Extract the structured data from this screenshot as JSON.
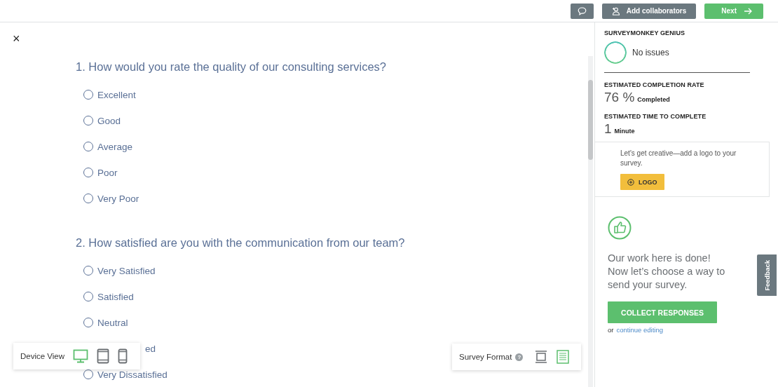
{
  "topbar": {
    "buttons": [
      {
        "kind": "comment"
      },
      {
        "kind": "collaborators",
        "label": "Add collaborators"
      },
      {
        "kind": "next",
        "label": "Next"
      }
    ]
  },
  "close_icon": "×",
  "questions": [
    {
      "title": "1. How would you rate the quality of our consulting services?",
      "options": [
        {
          "kind": "radio",
          "label": "Excellent",
          "selected": false
        },
        {
          "kind": "radio",
          "label": "Good",
          "selected": false
        },
        {
          "kind": "radio",
          "label": "Average",
          "selected": false
        },
        {
          "kind": "radio",
          "label": "Poor",
          "selected": false
        },
        {
          "kind": "radio",
          "label": "Very Poor",
          "selected": false
        }
      ]
    },
    {
      "title": "2. How satisfied are you with the communication from our team?",
      "options": [
        {
          "kind": "radio",
          "label": "Very Satisfied",
          "selected": false
        },
        {
          "kind": "radio",
          "label": "Satisfied",
          "selected": false
        },
        {
          "kind": "radio",
          "label": "Neutral",
          "selected": false
        },
        {
          "kind": "fragment",
          "label": "ed"
        },
        {
          "kind": "radio",
          "label": "Very Dissatisfied",
          "selected": false
        }
      ]
    }
  ],
  "device_view": {
    "label": "Device View",
    "devices": [
      {
        "kind": "desktop",
        "selected": true
      },
      {
        "kind": "tablet",
        "selected": false
      },
      {
        "kind": "phone",
        "selected": false
      }
    ]
  },
  "survey_format": {
    "label": "Survey Format",
    "help": "?",
    "formats": [
      {
        "kind": "one-at-a-time",
        "selected": false
      },
      {
        "kind": "classic",
        "selected": true
      }
    ]
  },
  "sidebar": {
    "genius_title": "SURVEYMONKEY GENIUS",
    "genius_status": "No issues",
    "completion_title": "ESTIMATED COMPLETION RATE",
    "completion_value": "76 %",
    "completion_unit": "Completed",
    "time_title": "ESTIMATED TIME TO COMPLETE",
    "time_value": "1",
    "time_unit": "Minute",
    "logo_text": "Let's get creative—add a logo to your survey.",
    "logo_button": "LOGO",
    "done_text": "Our work here is done! Now let’s choose a way to send your survey.",
    "collect_button": "COLLECT RESPONSES",
    "or_text": "or",
    "continue_link": "continue editing"
  },
  "feedback_tab": "Feedback"
}
